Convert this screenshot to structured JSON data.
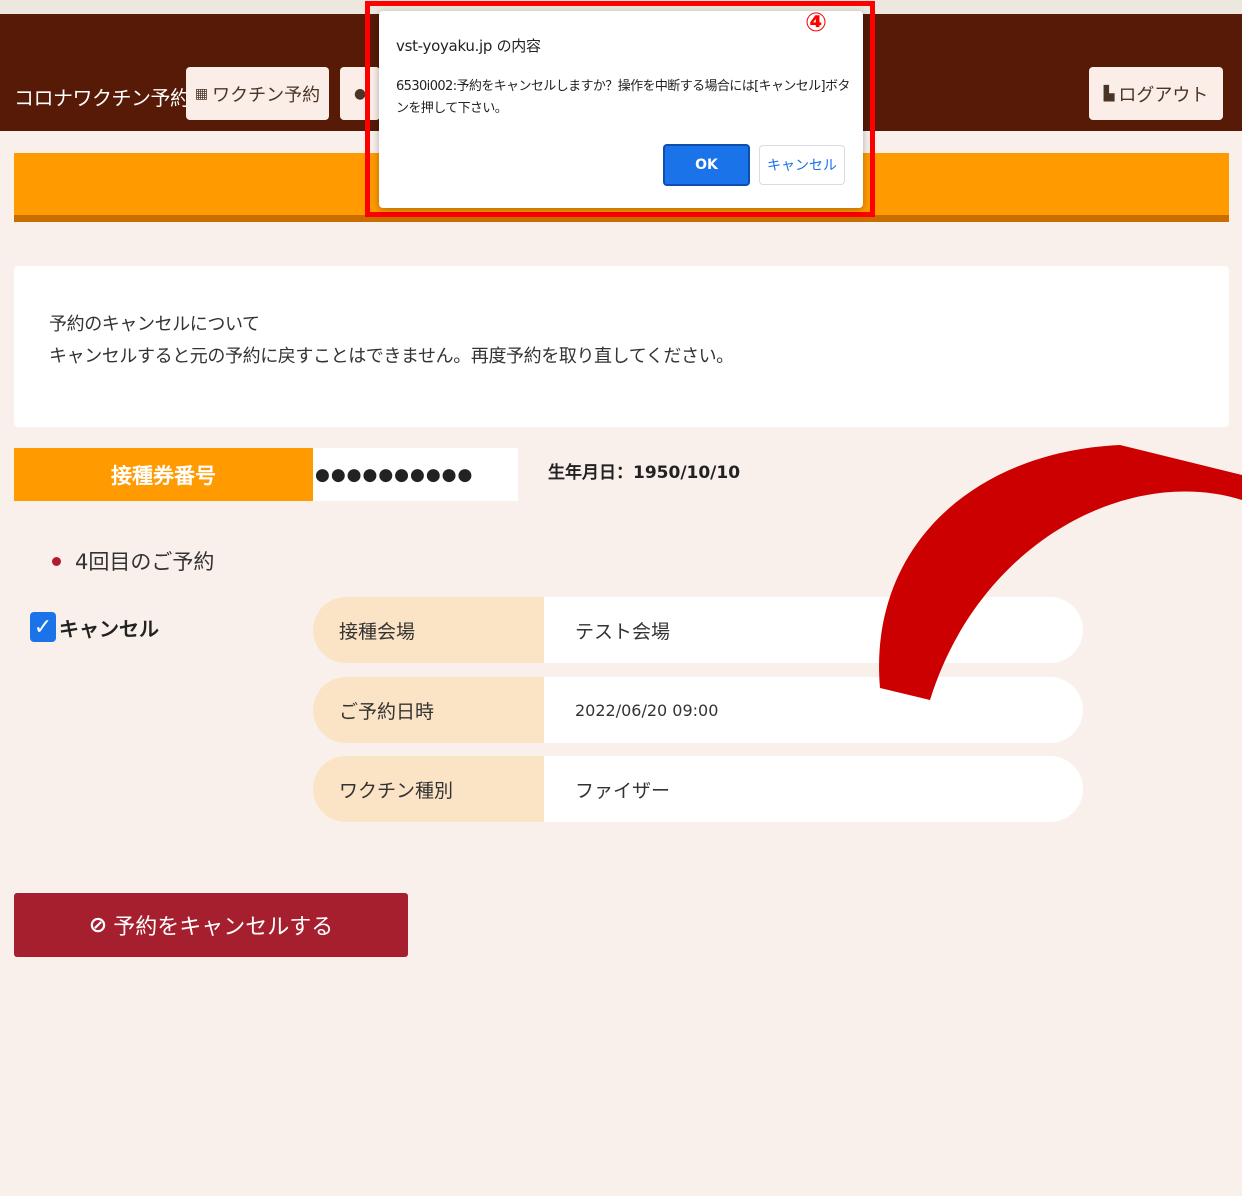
{
  "header": {
    "brand": "コロナワクチン予約",
    "vaccine_button": "ワクチン予約",
    "logout_button": "ログアウト"
  },
  "notice": {
    "title": "予約のキャンセルについて",
    "body": "キャンセルすると元の予約に戻すことはできません。再度予約を取り直してください。"
  },
  "ticket": {
    "label": "接種券番号",
    "value": "●●●●●●●●●●",
    "birth_label": "生年月日：",
    "birth_value": "1950/10/10"
  },
  "reservation": {
    "title": "4回目のご予約",
    "cancel_checkbox_label": "キャンセル",
    "cancel_checked": true,
    "rows": [
      {
        "key": "接種会場",
        "value": "テスト会場"
      },
      {
        "key": "ご予約日時",
        "value": "2022/06/20 09:00"
      },
      {
        "key": "ワクチン種別",
        "value": "ファイザー"
      }
    ]
  },
  "cancel_action": {
    "label": "予約をキャンセルする"
  },
  "dialog": {
    "title": "vst-yoyaku.jp の内容",
    "message": "6530i002:予約をキャンセルしますか？操作を中断する場合には[キャンセル]ボタンを押して下さい。",
    "ok_label": "OK",
    "cancel_label": "キャンセル"
  },
  "annotation": {
    "step": "④",
    "highlight_color": "#ff0000",
    "arrow_color": "#cc0000"
  },
  "colors": {
    "navbar": "#561a06",
    "orange": "#ff9a00",
    "button_red": "#a61f2f",
    "background": "#f9f0ec"
  }
}
